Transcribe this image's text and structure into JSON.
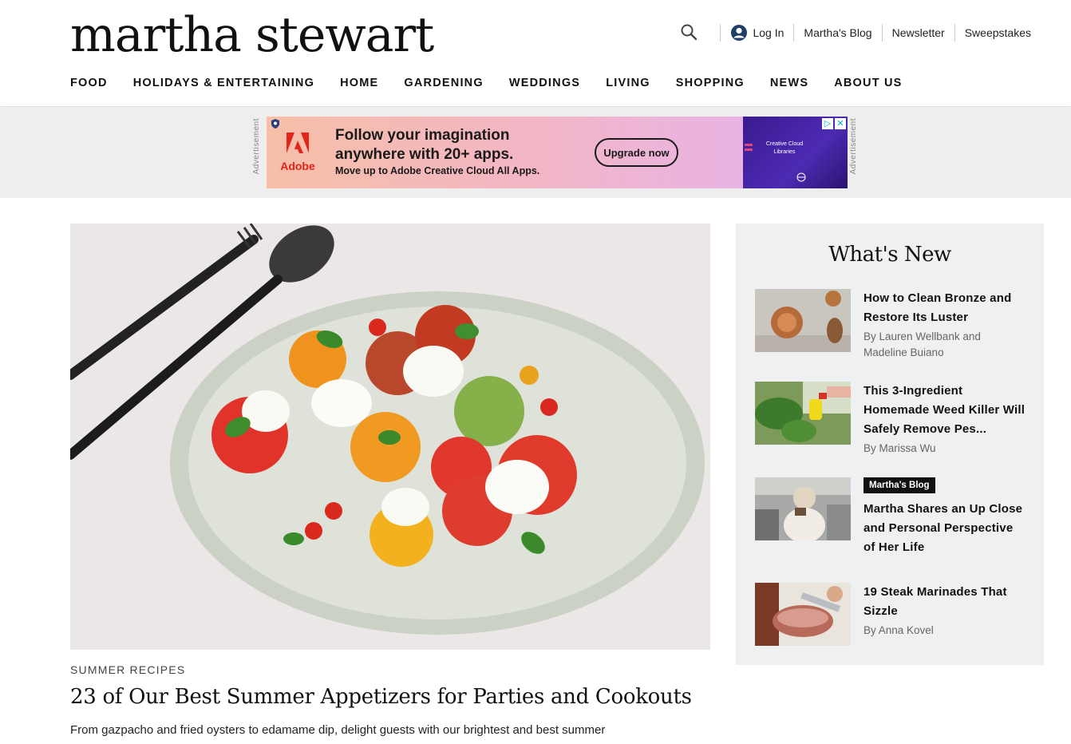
{
  "header": {
    "logo": "martha stewart",
    "utility": {
      "login": "Log In",
      "links": [
        "Martha's Blog",
        "Newsletter",
        "Sweepstakes"
      ]
    },
    "nav": [
      "FOOD",
      "HOLIDAYS & ENTERTAINING",
      "HOME",
      "GARDENING",
      "WEDDINGS",
      "LIVING",
      "SHOPPING",
      "NEWS",
      "ABOUT US"
    ]
  },
  "ad": {
    "label": "Advertisement",
    "brand": "Adobe",
    "headline": "Follow your imagination anywhere with 20+ apps.",
    "subline": "Move up to Adobe Creative Cloud All Apps.",
    "cta": "Upgrade now",
    "panel_text": "Creative Cloud Libraries",
    "colors": {
      "adobe_red": "#e1251b",
      "panel": "#3a1a8f"
    }
  },
  "hero": {
    "kicker": "SUMMER RECIPES",
    "title": "23 of Our Best Summer Appetizers for Parties and Cookouts",
    "description": "From gazpacho and fried oysters to edamame dip, delight guests with our brightest and best summer"
  },
  "sidebar": {
    "heading": "What's New",
    "items": [
      {
        "title": "How to Clean Bronze and Restore Its Luster",
        "byline": "By Lauren Wellbank and Madeline Buiano",
        "badge": ""
      },
      {
        "title": "This 3-Ingredient Homemade Weed Killer Will Safely Remove Pes...",
        "byline": "By Marissa Wu",
        "badge": ""
      },
      {
        "title": "Martha Shares an Up Close and Personal Perspective of Her Life",
        "byline": "",
        "badge": "Martha's Blog"
      },
      {
        "title": "19 Steak Marinades That Sizzle",
        "byline": "By Anna Kovel",
        "badge": ""
      }
    ]
  }
}
